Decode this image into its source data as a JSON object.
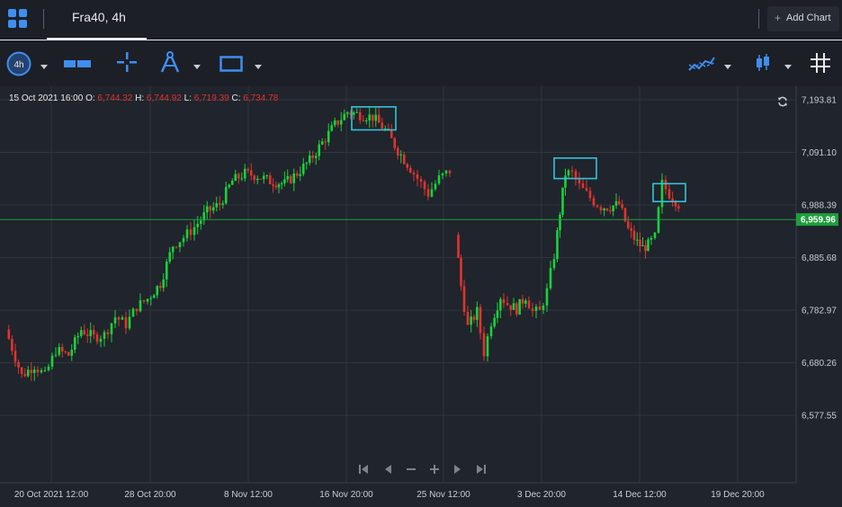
{
  "header": {
    "tab_title": "Fra40, 4h",
    "add_chart_label": "Add Chart"
  },
  "toolbar": {
    "interval_label": "4h"
  },
  "ohlc": {
    "datetime": "15 Oct 2021 16:00",
    "o_label": "O:",
    "o_value": "6,744.32",
    "h_label": "H:",
    "h_value": "6,744.92",
    "l_label": "L:",
    "l_value": "6,719.39",
    "c_label": "C:",
    "c_value": "6,734.78"
  },
  "colors": {
    "up": "#19d23c",
    "down": "#e0342f",
    "last_price": "#1e9e3c",
    "highlight": "#35c3d9",
    "accent": "#3f8ef0"
  },
  "chart_data": {
    "type": "candlestick",
    "title": "Fra40, 4h",
    "ylim": [
      6500,
      7230
    ],
    "y_ticks": [
      7193.81,
      7091.1,
      6988.39,
      6885.68,
      6782.97,
      6680.26,
      6577.55
    ],
    "y_tick_labels": [
      "7,193.81",
      "7,091.10",
      "6,988.39",
      "6,885.68",
      "6,782.97",
      "6,680.26",
      "6,577.55"
    ],
    "x_tick_labels": [
      "20 Oct 2021 12:00",
      "28 Oct 20:00",
      "8 Nov 12:00",
      "16 Nov 20:00",
      "25 Nov 12:00",
      "3 Dec 20:00",
      "14 Dec 12:00",
      "19 Dec 20:00"
    ],
    "last_price": 6959.96,
    "last_price_label": "6,959.96",
    "grid": true,
    "segments": [
      {
        "waypoints": [
          [
            8,
            6745
          ],
          [
            26,
            6655
          ],
          [
            40,
            6675
          ],
          [
            52,
            6655
          ],
          [
            64,
            6705
          ],
          [
            78,
            6695
          ],
          [
            92,
            6745
          ],
          [
            106,
            6730
          ],
          [
            118,
            6735
          ],
          [
            130,
            6770
          ],
          [
            142,
            6755
          ],
          [
            154,
            6790
          ],
          [
            166,
            6805
          ],
          [
            180,
            6835
          ],
          [
            194,
            6910
          ],
          [
            206,
            6925
          ],
          [
            218,
            6945
          ],
          [
            232,
            6975
          ],
          [
            246,
            6990
          ],
          [
            260,
            7035
          ],
          [
            274,
            7050
          ],
          [
            288,
            7045
          ],
          [
            302,
            7035
          ],
          [
            318,
            7030
          ],
          [
            332,
            7050
          ],
          [
            346,
            7075
          ],
          [
            360,
            7110
          ],
          [
            374,
            7145
          ],
          [
            388,
            7170
          ],
          [
            402,
            7165
          ],
          [
            416,
            7160
          ],
          [
            430,
            7135
          ],
          [
            444,
            7095
          ],
          [
            458,
            7060
          ],
          [
            470,
            7030
          ],
          [
            478,
            7010
          ],
          [
            490,
            7040
          ],
          [
            502,
            7055
          ]
        ]
      },
      {
        "waypoints": [
          [
            508,
            6930
          ],
          [
            514,
            6830
          ],
          [
            522,
            6750
          ],
          [
            532,
            6780
          ],
          [
            540,
            6700
          ],
          [
            548,
            6760
          ],
          [
            558,
            6810
          ],
          [
            566,
            6795
          ],
          [
            576,
            6785
          ],
          [
            586,
            6810
          ],
          [
            594,
            6780
          ],
          [
            602,
            6780
          ],
          [
            610,
            6820
          ],
          [
            618,
            6890
          ],
          [
            624,
            6975
          ],
          [
            630,
            7050
          ],
          [
            638,
            7050
          ],
          [
            646,
            7025
          ],
          [
            654,
            7010
          ],
          [
            662,
            6995
          ],
          [
            670,
            6985
          ],
          [
            680,
            6985
          ],
          [
            690,
            6990
          ],
          [
            700,
            6940
          ],
          [
            710,
            6915
          ],
          [
            716,
            6905
          ],
          [
            722,
            6910
          ],
          [
            730,
            6925
          ],
          [
            738,
            7030
          ],
          [
            746,
            7010
          ],
          [
            756,
            6990
          ]
        ]
      }
    ],
    "highlights": [
      {
        "x0": 391,
        "x1": 440,
        "y0": 7180,
        "y1": 7135
      },
      {
        "x0": 616,
        "x1": 663,
        "y0": 7080,
        "y1": 7040
      },
      {
        "x0": 726,
        "x1": 762,
        "y0": 7030,
        "y1": 6995
      }
    ]
  }
}
